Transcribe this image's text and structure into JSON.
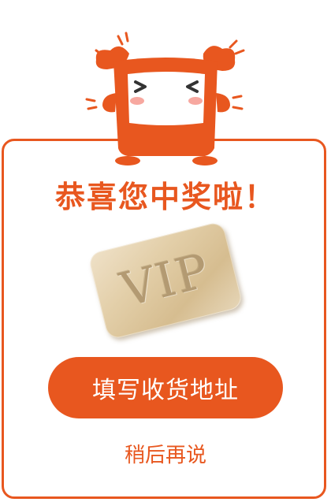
{
  "dialog": {
    "title": "恭喜您中奖啦！",
    "prize_label": "VIP",
    "primary_button": "填写收货地址",
    "secondary_link": "稍后再说"
  },
  "colors": {
    "accent": "#e8571f",
    "button_text": "#ffffff",
    "vip_card_gold": "#dcc59c"
  },
  "icons": {
    "mascot": "happy-mascot-icon"
  }
}
